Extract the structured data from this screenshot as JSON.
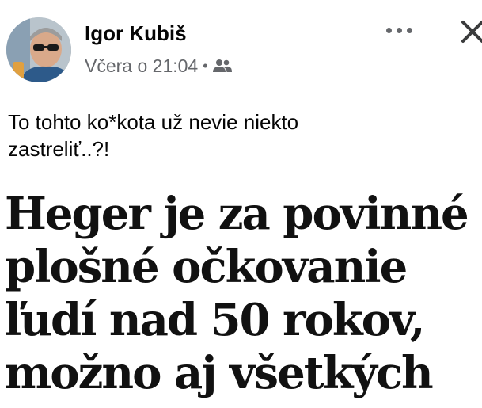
{
  "post": {
    "author": "Igor Kubiš",
    "timestamp": "Včera o 21:04",
    "separator": "•",
    "audience_icon": "friends-icon",
    "more_icon": "more-options-icon",
    "close_icon": "close-icon",
    "text_lines": [
      "To tohto ko*kota už nevie niekto",
      "zastreliť..?!"
    ]
  },
  "shared_image": {
    "headline_lines": [
      "Heger je za povinné",
      "plošné očkovanie",
      "ľudí nad 50 rokov,",
      "možno aj všetkých"
    ]
  },
  "colors": {
    "text": "#050505",
    "secondary_text": "#65676b",
    "background": "#ffffff"
  }
}
